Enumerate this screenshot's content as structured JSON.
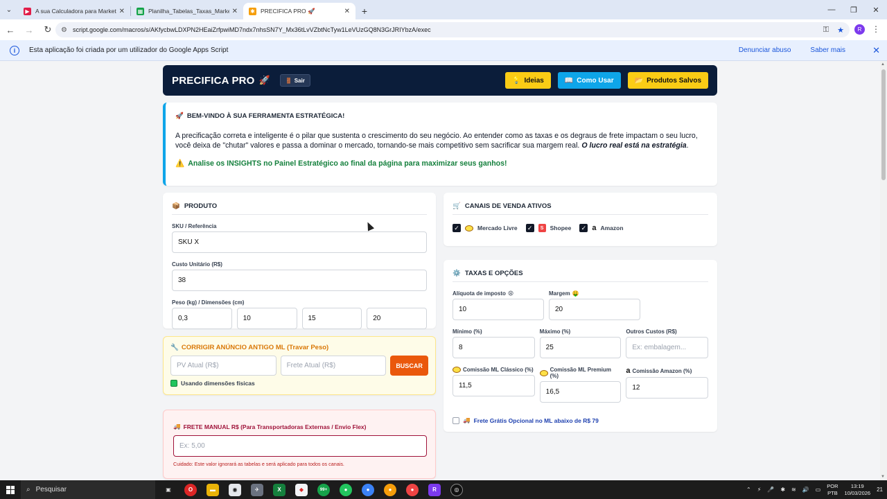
{
  "browser": {
    "tabs": [
      {
        "title": "A sua Calculadora para Marketp",
        "icon": "youtube-icon",
        "color": "#e11d48"
      },
      {
        "title": "Planilha_Tabelas_Taxas_Marketp",
        "icon": "sheets-icon",
        "color": "#16a34a"
      },
      {
        "title": "PRECIFICA PRO 🚀",
        "icon": "apps-script-icon",
        "color": "#f59e0b"
      }
    ],
    "url": "script.google.com/macros/s/AKfycbwLDXPN2HEaiZrfpwiMD7ndx7nhsSN7Y_Mx36tLvVZbtNcTyw1LeVUzGQ8N3GrJRIYbzA/exec",
    "profile_initial": "R"
  },
  "infobar": {
    "message": "Esta aplicação foi criada por um utilizador do Google Apps Script",
    "report": "Denunciar abuso",
    "learn_more": "Saber mais"
  },
  "header": {
    "brand": "PRECIFICA PRO",
    "logout": "Sair",
    "ideas": "Ideias",
    "how_to": "Como Usar",
    "saved": "Produtos Salvos"
  },
  "welcome": {
    "title": "BEM-VINDO À SUA FERRAMENTA ESTRATÉGICA!",
    "body": "A precificação correta e inteligente é o pilar que sustenta o crescimento do seu negócio. Ao entender como as taxas e os degraus de frete impactam o seu lucro, você deixa de \"chutar\" valores e passa a dominar o mercado, tornando-se mais competitivo sem sacrificar sua margem real.",
    "emphasis": "O lucro real está na estratégia",
    "insight": "Analise os INSIGHTS no Painel Estratégico ao final da página para maximizar seus ganhos!"
  },
  "produto": {
    "title": "PRODUTO",
    "sku_label": "SKU / Referência",
    "sku_value": "SKU X",
    "custo_label": "Custo Unitário (R$)",
    "custo_value": "38",
    "peso_label": "Peso (kg) / Dimensões (cm)",
    "peso": "0,3",
    "dim1": "10",
    "dim2": "15",
    "dim3": "20"
  },
  "canais": {
    "title": "CANAIS DE VENDA ATIVOS",
    "ml": "Mercado Livre",
    "shopee": "Shopee",
    "amazon": "Amazon"
  },
  "taxas": {
    "title": "TAXAS E OPÇÕES",
    "imposto_label": "Alíquota de imposto",
    "imposto_value": "10",
    "margem_label": "Margem",
    "margem_value": "20",
    "minimo_label": "Mínimo (%)",
    "minimo_value": "8",
    "maximo_label": "Máximo (%)",
    "maximo_value": "25",
    "outros_label": "Outros Custos (R$)",
    "outros_placeholder": "Ex: embalagem...",
    "ml_classico_label": "Comissão ML Clássico (%)",
    "ml_classico_value": "11,5",
    "ml_premium_label": "Comissão ML Premium (%)",
    "ml_premium_value": "16,5",
    "amazon_label": "Comissão Amazon (%)",
    "amazon_value": "12",
    "frete_gratis": "Frete Grátis Opcional no ML abaixo de R$ 79"
  },
  "corrigir": {
    "title": "CORRIGIR ANÚNCIO ANTIGO ML (Travar Peso)",
    "pv_placeholder": "PV Atual (R$)",
    "frete_placeholder": "Frete Atual (R$)",
    "button": "BUSCAR",
    "usando": "Usando dimensões físicas"
  },
  "frete_manual": {
    "title": "FRETE MANUAL R$ (Para Transportadoras Externas / Envio Flex)",
    "placeholder": "Ex: 5,00",
    "warning": "Cuidado: Este valor ignorará as tabelas e será aplicado para todos os canais."
  },
  "taskbar": {
    "search": "Pesquisar",
    "lang1": "POR",
    "lang2": "PTB",
    "time": "13:19",
    "date": "10/03/2026",
    "badge": "99+",
    "notif": "21"
  }
}
